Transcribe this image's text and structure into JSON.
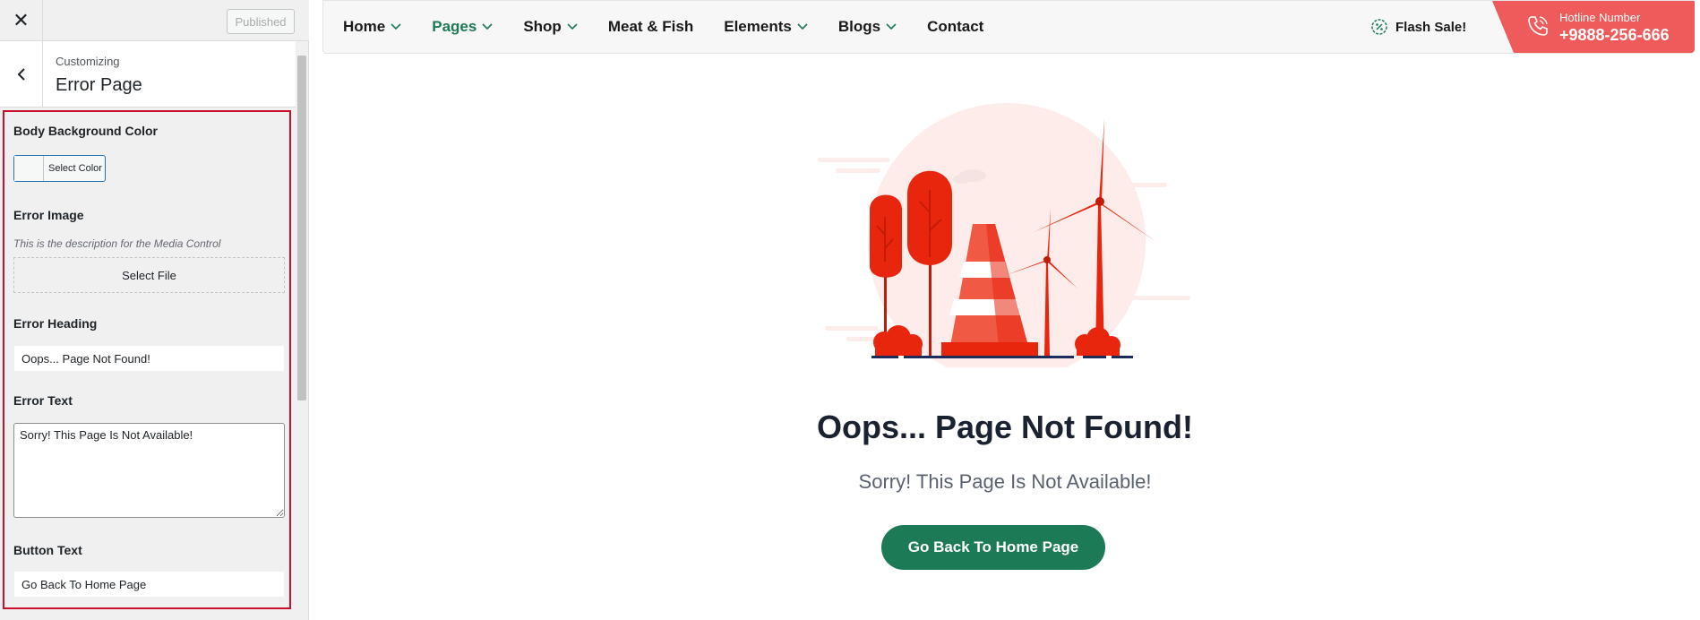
{
  "sidebar": {
    "close_symbol": "✕",
    "published_label": "Published",
    "customizing_label": "Customizing",
    "section_title": "Error Page",
    "fields": {
      "body_bg_label": "Body Background Color",
      "select_color_label": "Select Color",
      "error_image_label": "Error Image",
      "error_image_desc": "This is the description for the Media Control",
      "select_file_label": "Select File",
      "error_heading_label": "Error Heading",
      "error_heading_value": "Oops... Page Not Found!",
      "error_text_label": "Error Text",
      "error_text_value": "Sorry! This Page Is Not Available!",
      "button_text_label": "Button Text",
      "button_text_value": "Go Back To Home Page"
    }
  },
  "nav": {
    "items": [
      {
        "label": "Home",
        "has_dropdown": true
      },
      {
        "label": "Pages",
        "has_dropdown": true,
        "active": true
      },
      {
        "label": "Shop",
        "has_dropdown": true
      },
      {
        "label": "Meat & Fish",
        "has_dropdown": false
      },
      {
        "label": "Elements",
        "has_dropdown": true
      },
      {
        "label": "Blogs",
        "has_dropdown": true
      },
      {
        "label": "Contact",
        "has_dropdown": false
      }
    ],
    "flash_sale": "Flash Sale!",
    "hotline_label": "Hotline Number",
    "hotline_number": "+9888-256-666"
  },
  "main": {
    "heading": "Oops... Page Not Found!",
    "text": "Sorry! This Page Is Not Available!",
    "button": "Go Back To Home Page"
  },
  "icons": {
    "close": "close-icon",
    "back": "chevron-left-icon",
    "dropdown": "chevron-down-icon",
    "flash": "discount-badge-icon",
    "hotline": "phone-icon"
  },
  "colors": {
    "brand_green": "#1d7a57",
    "hotline_red": "#ef5a5a",
    "panel_highlight": "#c8102e",
    "illustration_red": "#e8260e"
  }
}
